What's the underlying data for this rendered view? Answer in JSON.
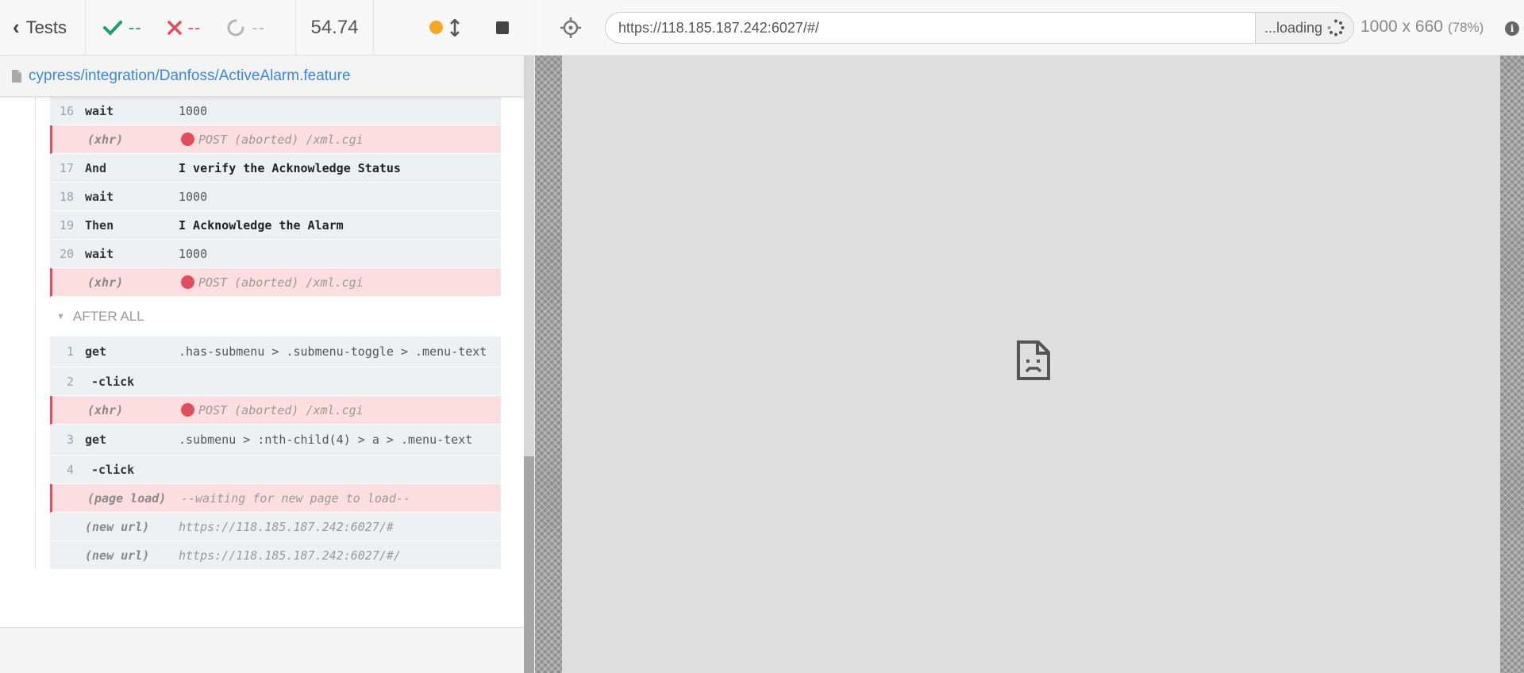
{
  "header": {
    "tests_label": "Tests",
    "passed": "--",
    "failed": "--",
    "pending": "--",
    "duration": "54.74"
  },
  "spec": {
    "path": "cypress/integration/Danfoss/ActiveAlarm.feature"
  },
  "commands": [
    {
      "num": "16",
      "name": "wait",
      "message": "1000",
      "type": "normal"
    },
    {
      "num": "",
      "name": "(xhr)",
      "message": "POST (aborted) /xml.cgi",
      "type": "failed"
    },
    {
      "num": "17",
      "name": "And",
      "message": "I verify the Acknowledge Status",
      "type": "step"
    },
    {
      "num": "18",
      "name": "wait",
      "message": "1000",
      "type": "normal"
    },
    {
      "num": "19",
      "name": "Then",
      "message": "I Acknowledge the Alarm",
      "type": "step"
    },
    {
      "num": "20",
      "name": "wait",
      "message": "1000",
      "type": "normal"
    },
    {
      "num": "",
      "name": "(xhr)",
      "message": "POST (aborted) /xml.cgi",
      "type": "failed"
    }
  ],
  "after_all": {
    "title": "AFTER ALL",
    "commands": [
      {
        "num": "1",
        "name": "get",
        "message": ".has-submenu > .submenu-toggle > .menu-text",
        "type": "multi"
      },
      {
        "num": "2",
        "name": "-click",
        "message": "",
        "type": "child"
      },
      {
        "num": "",
        "name": "(xhr)",
        "message": "POST (aborted) /xml.cgi",
        "type": "failed"
      },
      {
        "num": "3",
        "name": "get",
        "message": ".submenu > :nth-child(4) > a > .menu-text",
        "type": "multi"
      },
      {
        "num": "4",
        "name": "-click",
        "message": "",
        "type": "child"
      },
      {
        "num": "",
        "name": "(page load)",
        "message": "--waiting for new page to load--",
        "type": "failed-nodot"
      },
      {
        "num": "",
        "name": "(new url)",
        "message": "https://118.185.187.242:6027/#",
        "type": "ital"
      },
      {
        "num": "",
        "name": "(new url)",
        "message": "https://118.185.187.242:6027/#/",
        "type": "ital"
      }
    ]
  },
  "aut": {
    "url": "https://118.185.187.242:6027/#/",
    "loading_label": "...loading",
    "viewport": "1000 x 660",
    "scale": "(78%)",
    "info_glyph": "i"
  },
  "colors": {
    "pass": "#1d9d74",
    "fail": "#e04e5d",
    "pending_ring": "#b5b5b5",
    "running": "#f5a623",
    "link": "#3d86d8"
  },
  "icons": {
    "back": "chevron-left-icon",
    "passed": "check-icon",
    "failed": "x-icon",
    "pending": "circle-notch-icon",
    "running": "dot-icon",
    "scroll": "arrows-vertical-icon",
    "stop": "stop-icon",
    "selector": "crosshair-icon",
    "file": "file-icon",
    "error": "sad-file-icon"
  }
}
